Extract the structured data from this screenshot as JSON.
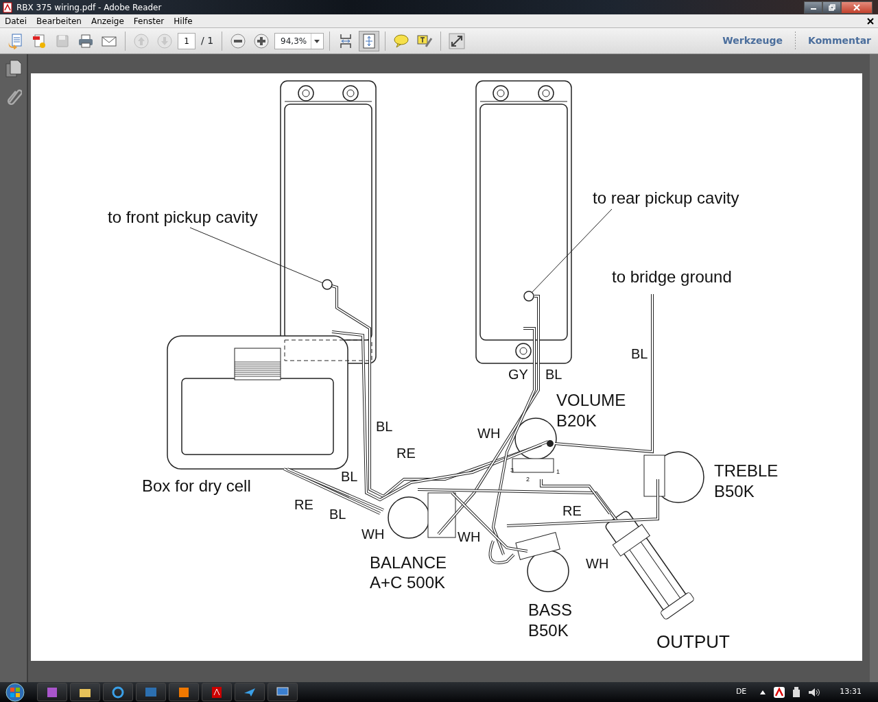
{
  "window": {
    "title": "RBX 375 wiring.pdf - Adobe Reader"
  },
  "menu": [
    "Datei",
    "Bearbeiten",
    "Anzeige",
    "Fenster",
    "Hilfe"
  ],
  "toolbar": {
    "page_number": "1",
    "page_count": "/ 1",
    "zoom": "94,3%",
    "view_modes": [
      {
        "selected": false
      },
      {
        "selected": true
      }
    ],
    "panels": [
      "Werkzeuge",
      "Kommentar"
    ]
  },
  "diagram": {
    "labels": [
      "to front pickup cavity",
      "to rear pickup cavity",
      "to bridge ground",
      "BL",
      "GY",
      "BL",
      "VOLUME",
      "B20K",
      "WH",
      "BL",
      "RE",
      "TREBLE",
      "B50K",
      "BL",
      "Box for dry cell",
      "RE",
      "BL",
      "WH",
      "WH",
      "RE",
      "WH",
      "BALANCE",
      "A+C 500K",
      "BASS",
      "B50K",
      "OUTPUT",
      "3",
      "2",
      "1"
    ]
  },
  "taskbar": {
    "language": "DE",
    "clock": "13:31"
  }
}
